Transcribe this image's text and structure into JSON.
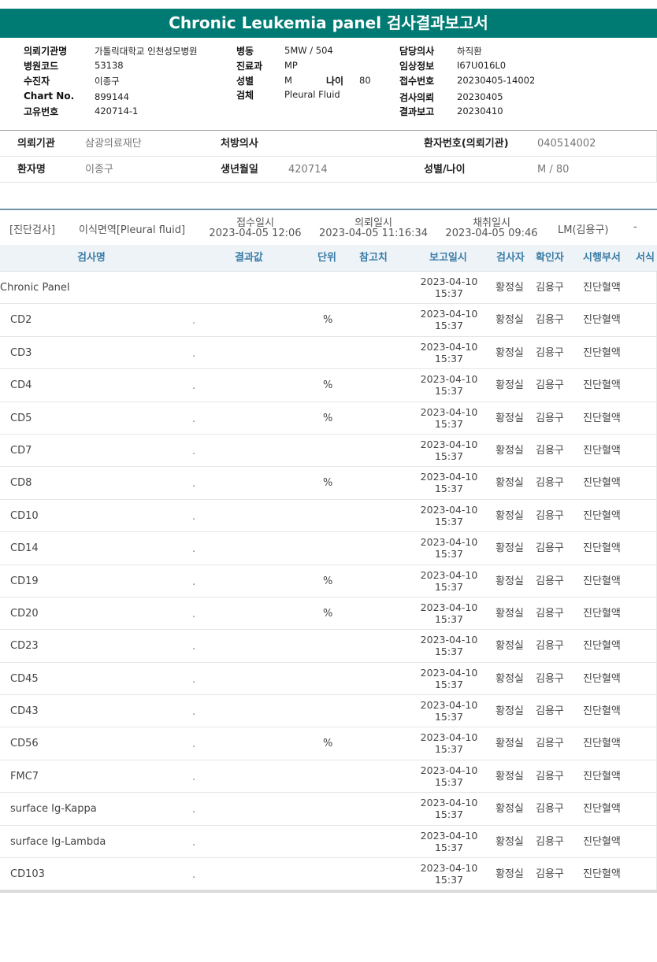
{
  "title": "Chronic Leukemia panel 검사결과보고서",
  "report_info": {
    "col1": [
      {
        "label": "의뢰기관명",
        "value": "가톨릭대학교 인천성모병원"
      },
      {
        "label": "병원코드",
        "value": "53138"
      },
      {
        "label": "수진자",
        "value": "이종구"
      },
      {
        "label": "Chart No.",
        "value": "899144"
      },
      {
        "label": "고유번호",
        "value": "420714-1"
      }
    ],
    "col2": [
      {
        "label": "병동",
        "value": "5MW / 504"
      },
      {
        "label": "진료과",
        "value": "MP"
      },
      {
        "label": "성별",
        "value": "M"
      },
      {
        "label": "검체",
        "value": "Pleural Fluid"
      }
    ],
    "age": {
      "label": "나이",
      "value": "80"
    },
    "col3": [
      {
        "label": "담당의사",
        "value": "하직환"
      },
      {
        "label": "임상정보",
        "value": "I67U016L0"
      },
      {
        "label": "접수번호",
        "value": "20230405-14002"
      },
      {
        "label": "검사의뢰",
        "value": "20230405"
      },
      {
        "label": "결과보고",
        "value": "20230410"
      }
    ]
  },
  "patient": {
    "institution_label": "의뢰기관",
    "institution": "삼광의료재단",
    "doctor_label": "처방의사",
    "doctor": "",
    "patient_no_label": "환자번호(의뢰기관)",
    "patient_no": "040514002",
    "name_label": "환자명",
    "name": "이종구",
    "dob_label": "생년월일",
    "dob": "420714",
    "sex_age_label": "성별/나이",
    "sex_age": "M / 80"
  },
  "order": {
    "category": "[진단검사]",
    "test_name": "이식면역[Pleural fluid]",
    "received_label": "접수일시",
    "received": "2023-04-05 12:06",
    "requested_label": "의뢰일시",
    "requested": "2023-04-05 11:16:34",
    "collected_label": "채취일시",
    "collected": "2023-04-05 09:46",
    "lab": "LM(김용구)",
    "extra": "-"
  },
  "table_headers": {
    "test": "검사명",
    "result": "결과값",
    "unit": "단위",
    "reference": "참고치",
    "report_time": "보고일시",
    "tester": "검사자",
    "confirmer": "확인자",
    "department": "시행부서",
    "format": "서식"
  },
  "results": [
    {
      "name": "Chronic Panel",
      "result": "",
      "unit": "",
      "date": "2023-04-10",
      "time": "15:37",
      "tester": "황정실",
      "confirmer": "김용구",
      "dept": "진단혈액"
    },
    {
      "name": "CD2",
      "result": ".",
      "unit": "%",
      "date": "2023-04-10",
      "time": "15:37",
      "tester": "황정실",
      "confirmer": "김용구",
      "dept": "진단혈액"
    },
    {
      "name": "CD3",
      "result": ".",
      "unit": "",
      "date": "2023-04-10",
      "time": "15:37",
      "tester": "황정실",
      "confirmer": "김용구",
      "dept": "진단혈액"
    },
    {
      "name": "CD4",
      "result": ".",
      "unit": "%",
      "date": "2023-04-10",
      "time": "15:37",
      "tester": "황정실",
      "confirmer": "김용구",
      "dept": "진단혈액"
    },
    {
      "name": "CD5",
      "result": ".",
      "unit": "%",
      "date": "2023-04-10",
      "time": "15:37",
      "tester": "황정실",
      "confirmer": "김용구",
      "dept": "진단혈액"
    },
    {
      "name": "CD7",
      "result": ".",
      "unit": "",
      "date": "2023-04-10",
      "time": "15:37",
      "tester": "황정실",
      "confirmer": "김용구",
      "dept": "진단혈액"
    },
    {
      "name": "CD8",
      "result": ".",
      "unit": "%",
      "date": "2023-04-10",
      "time": "15:37",
      "tester": "황정실",
      "confirmer": "김용구",
      "dept": "진단혈액"
    },
    {
      "name": "CD10",
      "result": ".",
      "unit": "",
      "date": "2023-04-10",
      "time": "15:37",
      "tester": "황정실",
      "confirmer": "김용구",
      "dept": "진단혈액"
    },
    {
      "name": "CD14",
      "result": ".",
      "unit": "",
      "date": "2023-04-10",
      "time": "15:37",
      "tester": "황정실",
      "confirmer": "김용구",
      "dept": "진단혈액"
    },
    {
      "name": "CD19",
      "result": ".",
      "unit": "%",
      "date": "2023-04-10",
      "time": "15:37",
      "tester": "황정실",
      "confirmer": "김용구",
      "dept": "진단혈액"
    },
    {
      "name": "CD20",
      "result": ".",
      "unit": "%",
      "date": "2023-04-10",
      "time": "15:37",
      "tester": "황정실",
      "confirmer": "김용구",
      "dept": "진단혈액"
    },
    {
      "name": "CD23",
      "result": ".",
      "unit": "",
      "date": "2023-04-10",
      "time": "15:37",
      "tester": "황정실",
      "confirmer": "김용구",
      "dept": "진단혈액"
    },
    {
      "name": "CD45",
      "result": ".",
      "unit": "",
      "date": "2023-04-10",
      "time": "15:37",
      "tester": "황정실",
      "confirmer": "김용구",
      "dept": "진단혈액"
    },
    {
      "name": "CD43",
      "result": ".",
      "unit": "",
      "date": "2023-04-10",
      "time": "15:37",
      "tester": "황정실",
      "confirmer": "김용구",
      "dept": "진단혈액"
    },
    {
      "name": "CD56",
      "result": ".",
      "unit": "%",
      "date": "2023-04-10",
      "time": "15:37",
      "tester": "황정실",
      "confirmer": "김용구",
      "dept": "진단혈액"
    },
    {
      "name": "FMC7",
      "result": ".",
      "unit": "",
      "date": "2023-04-10",
      "time": "15:37",
      "tester": "황정실",
      "confirmer": "김용구",
      "dept": "진단혈액"
    },
    {
      "name": "surface Ig-Kappa",
      "result": ".",
      "unit": "",
      "date": "2023-04-10",
      "time": "15:37",
      "tester": "황정실",
      "confirmer": "김용구",
      "dept": "진단혈액"
    },
    {
      "name": "surface Ig-Lambda",
      "result": ".",
      "unit": "",
      "date": "2023-04-10",
      "time": "15:37",
      "tester": "황정실",
      "confirmer": "김용구",
      "dept": "진단혈액"
    },
    {
      "name": "CD103",
      "result": ".",
      "unit": "",
      "date": "2023-04-10",
      "time": "15:37",
      "tester": "황정실",
      "confirmer": "김용구",
      "dept": "진단혈액"
    }
  ],
  "colors": {
    "title_bg": "#007b73",
    "header_text": "#3a7ca5",
    "header_bg": "#eef3f8"
  }
}
